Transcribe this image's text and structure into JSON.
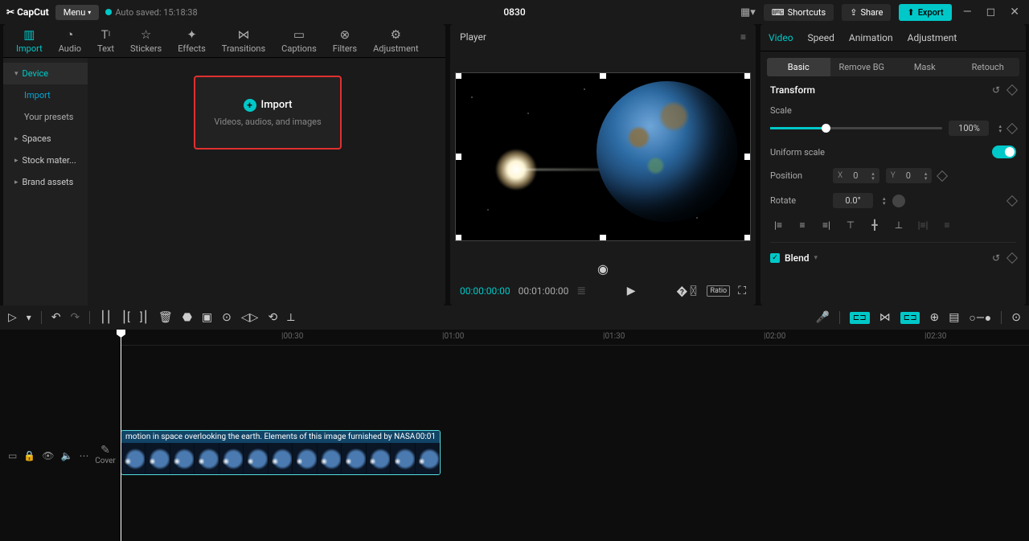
{
  "titlebar": {
    "app_name": "CapCut",
    "menu_label": "Menu",
    "autosave_label": "Auto saved: 15:18:38",
    "project_title": "0830",
    "shortcuts_label": "Shortcuts",
    "share_label": "Share",
    "export_label": "Export"
  },
  "media_tabs": [
    {
      "label": "Import"
    },
    {
      "label": "Audio"
    },
    {
      "label": "Text"
    },
    {
      "label": "Stickers"
    },
    {
      "label": "Effects"
    },
    {
      "label": "Transitions"
    },
    {
      "label": "Captions"
    },
    {
      "label": "Filters"
    },
    {
      "label": "Adjustment"
    }
  ],
  "side_nav": {
    "device": "Device",
    "import": "Import",
    "presets": "Your presets",
    "spaces": "Spaces",
    "stock": "Stock mater...",
    "brand": "Brand assets"
  },
  "import_box": {
    "title": "Import",
    "subtitle": "Videos, audios, and images"
  },
  "player": {
    "header": "Player",
    "current_time": "00:00:00:00",
    "duration": "00:01:00:00",
    "ratio_label": "Ratio"
  },
  "props": {
    "tabs": {
      "video": "Video",
      "speed": "Speed",
      "animation": "Animation",
      "adjustment": "Adjustment"
    },
    "subtabs": {
      "basic": "Basic",
      "removebg": "Remove BG",
      "mask": "Mask",
      "retouch": "Retouch"
    },
    "transform_label": "Transform",
    "scale_label": "Scale",
    "scale_value": "100%",
    "uniform_label": "Uniform scale",
    "position_label": "Position",
    "pos_x_label": "X",
    "pos_x_value": "0",
    "pos_y_label": "Y",
    "pos_y_value": "0",
    "rotate_label": "Rotate",
    "rotate_value": "0.0°",
    "blend_label": "Blend"
  },
  "timeline": {
    "ticks": [
      "|00:30",
      "|01:00",
      "|01:30",
      "|02:00",
      "|02:30"
    ],
    "cover_label": "Cover",
    "clip_title": "motion in space overlooking the earth. Elements of this image furnished by NASA",
    "clip_dur": "00:01"
  }
}
